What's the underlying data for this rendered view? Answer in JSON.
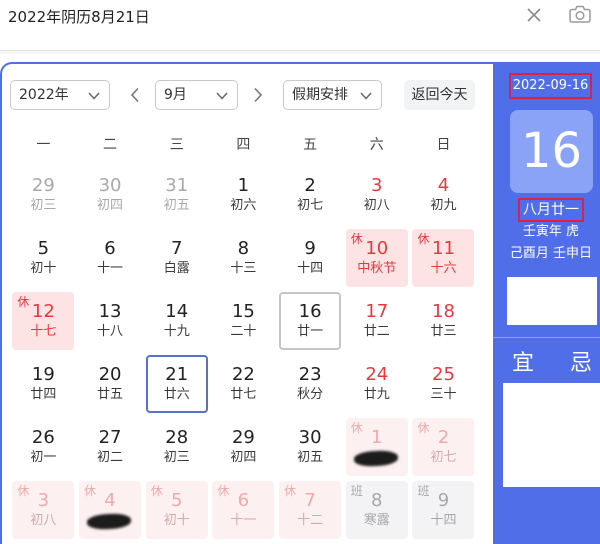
{
  "search": {
    "query": "2022年阴历8月21日"
  },
  "icons": {
    "clear": "close-icon",
    "image_search": "camera-icon",
    "dropdown": "chevron-down-icon",
    "prev": "chevron-left-icon",
    "next": "chevron-right-icon"
  },
  "colors": {
    "accent": "#4f6ee8",
    "red": "#e8383d",
    "holiday_bg": "#fde3e3",
    "next_holiday_bg": "#fdf0f0",
    "next_red": "#eea9a9",
    "work_bg": "#f3f3f5",
    "muted": "#a9a9a9",
    "selected": "#5573c9",
    "today_border": "#c6c6c6",
    "annotation": "#e3203c",
    "day_box": "#8ba3f6"
  },
  "controls": {
    "year": "2022年",
    "month": "9月",
    "holiday_menu": "假期安排",
    "today_button": "返回今天"
  },
  "weekdays": [
    "一",
    "二",
    "三",
    "四",
    "五",
    "六",
    "日"
  ],
  "weeks": [
    [
      {
        "num": "29",
        "lunar": "初三",
        "other_month": true
      },
      {
        "num": "30",
        "lunar": "初四",
        "other_month": true
      },
      {
        "num": "31",
        "lunar": "初五",
        "other_month": true
      },
      {
        "num": "1",
        "lunar": "初六"
      },
      {
        "num": "2",
        "lunar": "初七"
      },
      {
        "num": "3",
        "lunar": "初八",
        "weekend": true
      },
      {
        "num": "4",
        "lunar": "初九",
        "weekend": true
      }
    ],
    [
      {
        "num": "5",
        "lunar": "初十"
      },
      {
        "num": "6",
        "lunar": "十一"
      },
      {
        "num": "7",
        "lunar": "白露"
      },
      {
        "num": "8",
        "lunar": "十三"
      },
      {
        "num": "9",
        "lunar": "十四"
      },
      {
        "num": "10",
        "lunar": "中秋节",
        "holiday": true,
        "badge": "休"
      },
      {
        "num": "11",
        "lunar": "十六",
        "holiday": true,
        "badge": "休"
      }
    ],
    [
      {
        "num": "12",
        "lunar": "十七",
        "holiday": true,
        "badge": "休"
      },
      {
        "num": "13",
        "lunar": "十八"
      },
      {
        "num": "14",
        "lunar": "十九"
      },
      {
        "num": "15",
        "lunar": "二十"
      },
      {
        "num": "16",
        "lunar": "廿一",
        "today": true
      },
      {
        "num": "17",
        "lunar": "廿二",
        "weekend": true
      },
      {
        "num": "18",
        "lunar": "廿三",
        "weekend": true
      }
    ],
    [
      {
        "num": "19",
        "lunar": "廿四"
      },
      {
        "num": "20",
        "lunar": "廿五"
      },
      {
        "num": "21",
        "lunar": "廿六",
        "selected": true
      },
      {
        "num": "22",
        "lunar": "廿七"
      },
      {
        "num": "23",
        "lunar": "秋分"
      },
      {
        "num": "24",
        "lunar": "廿九",
        "weekend": true
      },
      {
        "num": "25",
        "lunar": "三十",
        "weekend": true
      }
    ],
    [
      {
        "num": "26",
        "lunar": "初一"
      },
      {
        "num": "27",
        "lunar": "初二"
      },
      {
        "num": "28",
        "lunar": "初三"
      },
      {
        "num": "29",
        "lunar": "初四"
      },
      {
        "num": "30",
        "lunar": "初五"
      },
      {
        "num": "1",
        "next_month": true,
        "holiday": true,
        "badge": "休",
        "obscured": true
      },
      {
        "num": "2",
        "lunar": "初七",
        "next_month": true,
        "holiday": true,
        "badge": "休"
      }
    ],
    [
      {
        "num": "3",
        "lunar": "初八",
        "next_month": true,
        "holiday": true,
        "badge": "休"
      },
      {
        "num": "4",
        "next_month": true,
        "holiday": true,
        "badge": "休",
        "obscured": true
      },
      {
        "num": "5",
        "lunar": "初十",
        "next_month": true,
        "holiday": true,
        "badge": "休"
      },
      {
        "num": "6",
        "lunar": "十一",
        "next_month": true,
        "holiday": true,
        "badge": "休"
      },
      {
        "num": "7",
        "lunar": "十二",
        "next_month": true,
        "holiday": true,
        "badge": "休"
      },
      {
        "num": "8",
        "lunar": "寒露",
        "next_month": true,
        "workday": true,
        "badge": "班"
      },
      {
        "num": "9",
        "lunar": "十四",
        "next_month": true,
        "workday": true,
        "badge": "班"
      }
    ]
  ],
  "panel": {
    "date": "2022-09-16",
    "day": "16",
    "lunar": "八月廿一",
    "year_ganzhi": "壬寅年 虎",
    "month_day_ganzhi": "己酉月 壬申日",
    "yi": "宜",
    "ji": "忌"
  }
}
